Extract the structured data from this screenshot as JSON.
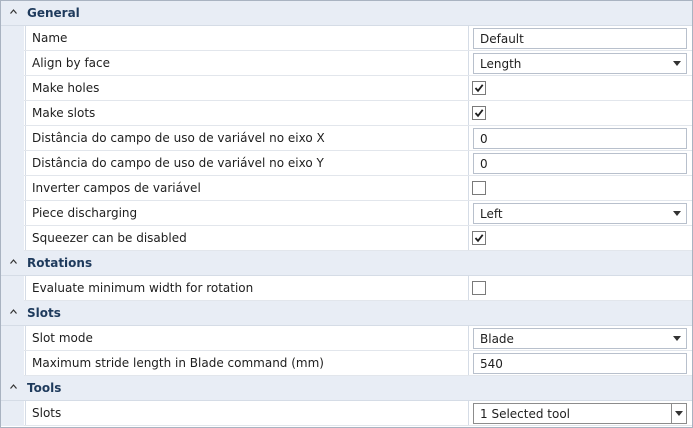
{
  "categories": {
    "general": {
      "title": "General",
      "rows": {
        "name": {
          "label": "Name",
          "value": "Default"
        },
        "align": {
          "label": "Align by face",
          "value": "Length"
        },
        "holes": {
          "label": "Make holes",
          "checked": true
        },
        "slots": {
          "label": "Make slots",
          "checked": true
        },
        "distx": {
          "label": "Distância do campo de uso de variável no eixo X",
          "value": "0"
        },
        "disty": {
          "label": "Distância do campo de uso de variável no eixo Y",
          "value": "0"
        },
        "invert": {
          "label": "Inverter campos de variável",
          "checked": false
        },
        "piece": {
          "label": "Piece discharging",
          "value": "Left"
        },
        "squeezer": {
          "label": "Squeezer can be disabled",
          "checked": true
        }
      }
    },
    "rotations": {
      "title": "Rotations",
      "rows": {
        "minwidth": {
          "label": "Evaluate minimum width for rotation",
          "checked": false
        }
      }
    },
    "slots": {
      "title": "Slots",
      "rows": {
        "mode": {
          "label": "Slot mode",
          "value": "Blade"
        },
        "stride": {
          "label": "Maximum stride length in Blade command (mm)",
          "value": "540"
        }
      }
    },
    "tools": {
      "title": "Tools",
      "rows": {
        "slots": {
          "label": "Slots",
          "value": "1 Selected tool"
        }
      }
    }
  },
  "icons": {
    "collapse": "chevron-up-icon",
    "dropdown": "dropdown-arrow-icon",
    "check": "check-icon"
  }
}
